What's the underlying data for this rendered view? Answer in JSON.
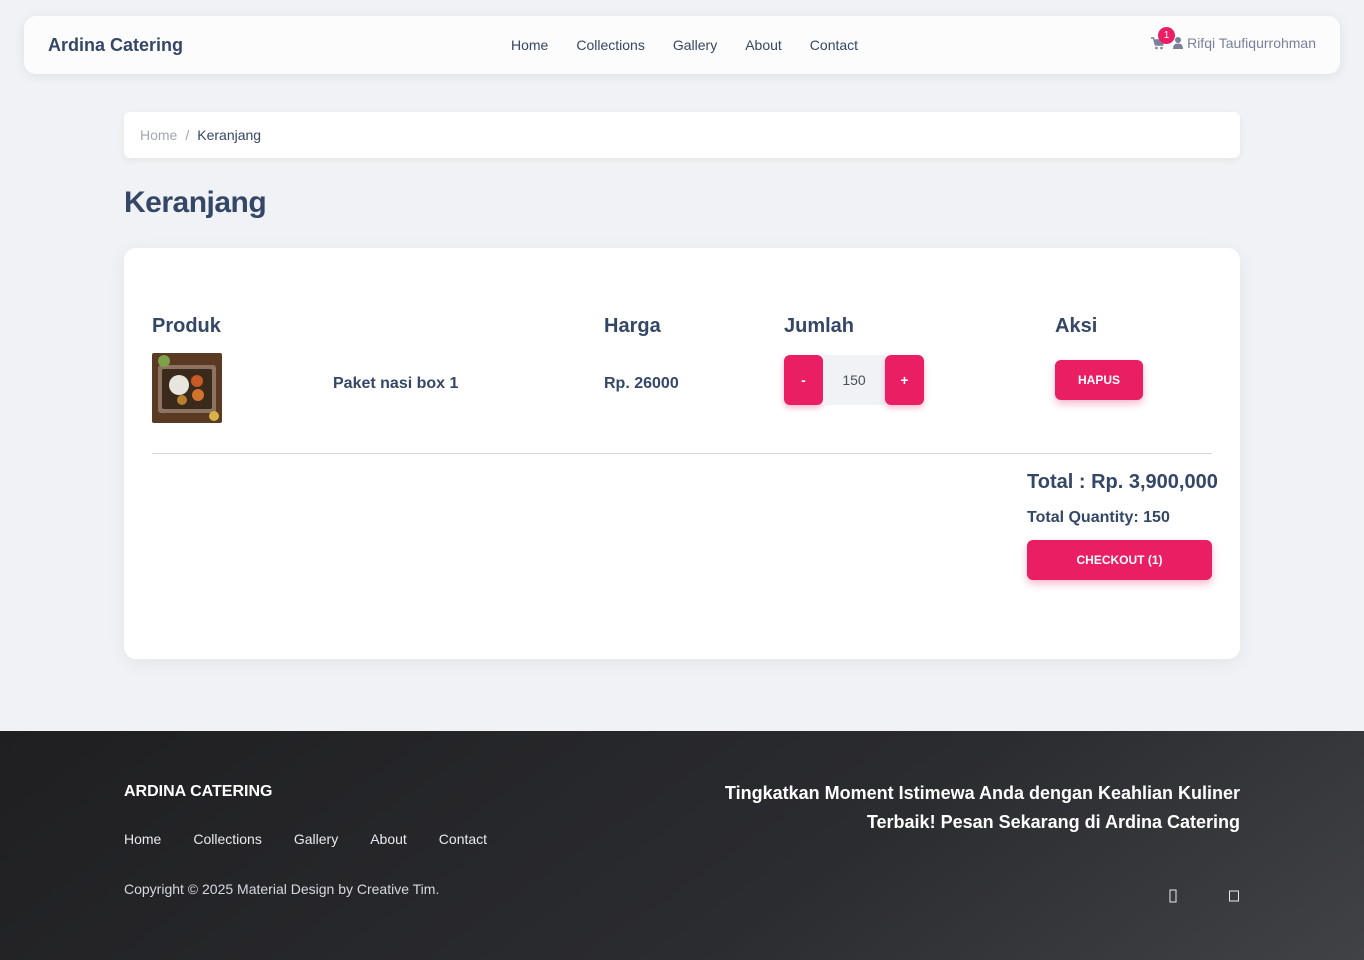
{
  "navbar": {
    "brand": "Ardina Catering",
    "links": [
      "Home",
      "Collections",
      "Gallery",
      "About",
      "Contact"
    ],
    "cart_count": "1",
    "user_name": "Rifqi Taufiqurrohman"
  },
  "breadcrumb": {
    "home": "Home",
    "separator": "/",
    "current": "Keranjang"
  },
  "page_title": "Keranjang",
  "cart": {
    "headers": {
      "product": "Produk",
      "price": "Harga",
      "quantity": "Jumlah",
      "action": "Aksi"
    },
    "items": [
      {
        "name": "Paket nasi box 1",
        "price": "Rp. 26000",
        "quantity": "150",
        "decrement_label": "-",
        "increment_label": "+",
        "remove_label": "HAPUS"
      }
    ],
    "total": "Total : Rp. 3,900,000",
    "total_quantity": "Total Quantity: 150",
    "checkout_label": "CHECKOUT (1)"
  },
  "footer": {
    "brand": "ARDINA CATERING",
    "links": [
      "Home",
      "Collections",
      "Gallery",
      "About",
      "Contact"
    ],
    "copyright": "Copyright © 2025 Material Design by Creative Tim.",
    "tagline": "Tingkatkan Moment Istimewa Anda dengan Keahlian Kuliner Terbaik! Pesan Sekarang di Ardina Catering"
  },
  "colors": {
    "accent": "#e91e63",
    "text": "#344767",
    "background": "#f0f2f5"
  }
}
